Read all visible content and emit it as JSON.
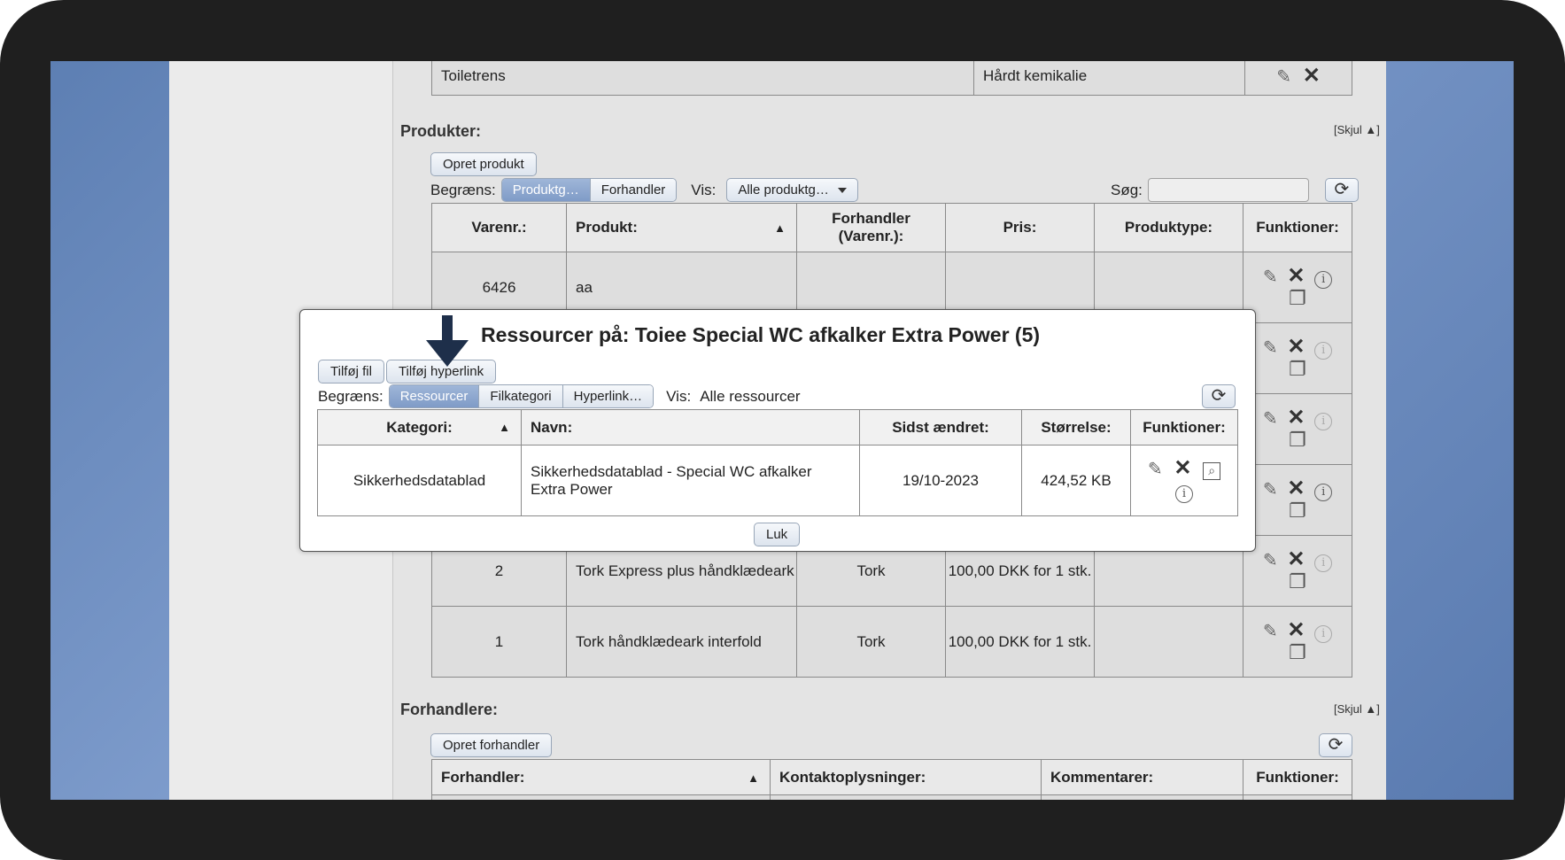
{
  "top_row": {
    "name": "Toiletrens",
    "type": "Hårdt kemikalie"
  },
  "produkter": {
    "title": "Produkter:",
    "skjul": "[Skjul",
    "create_button": "Opret produkt",
    "begraens_label": "Begræns:",
    "filter_tabs": [
      "Produktg…",
      "Forhandler"
    ],
    "vis_label": "Vis:",
    "vis_value": "Alle produktg…",
    "search_label": "Søg:",
    "search_value": "",
    "columns": [
      "Varenr.:",
      "Produkt:",
      "Forhandler (Varenr.):",
      "Pris:",
      "Produktype:",
      "Funktioner:"
    ],
    "rows": [
      {
        "varenr": "6426",
        "produkt": "aa",
        "forhandler": "",
        "pris": "",
        "type": ""
      },
      {
        "varenr": "2",
        "produkt": "Tork Express plus håndklædeark",
        "forhandler": "Tork",
        "pris": "100,00 DKK for 1 stk.",
        "type": ""
      },
      {
        "varenr": "1",
        "produkt": "Tork håndklædeark interfold",
        "forhandler": "Tork",
        "pris": "100,00 DKK for 1 stk.",
        "type": ""
      }
    ]
  },
  "forhandlere": {
    "title": "Forhandlere:",
    "skjul": "[Skjul",
    "create_button": "Opret forhandler",
    "columns": [
      "Forhandler:",
      "Kontaktoplysninger:",
      "Kommentarer:",
      "Funktioner:"
    ]
  },
  "modal": {
    "title": "Ressourcer på: Toiee Special WC afkalker Extra Power (5)",
    "add_file": "Tilføj fil",
    "add_link": "Tilføj hyperlink",
    "begraens_label": "Begræns:",
    "filter_tabs": [
      "Ressourcer",
      "Filkategori",
      "Hyperlink…"
    ],
    "vis_label": "Vis:",
    "vis_value": "Alle ressourcer",
    "columns": [
      "Kategori:",
      "Navn:",
      "Sidst ændret:",
      "Størrelse:",
      "Funktioner:"
    ],
    "row": {
      "kategori": "Sikkerhedsdatablad",
      "navn": "Sikkerhedsdatablad - Special WC afkalker Extra Power",
      "sidst_aendret": "19/10-2023",
      "stoerrelse": "424,52 KB"
    },
    "close_button": "Luk"
  },
  "icons": {
    "edit": "pencil-icon",
    "delete": "x-icon",
    "info": "info-icon",
    "copy": "copy-icon",
    "preview": "magnifier-icon",
    "refresh": "refresh-icon",
    "sort": "sort-asc-icon",
    "pointer": "arrow-down-icon"
  },
  "colors": {
    "active_tab": "#8aa4cc",
    "arrow": "#1e2f4a"
  }
}
